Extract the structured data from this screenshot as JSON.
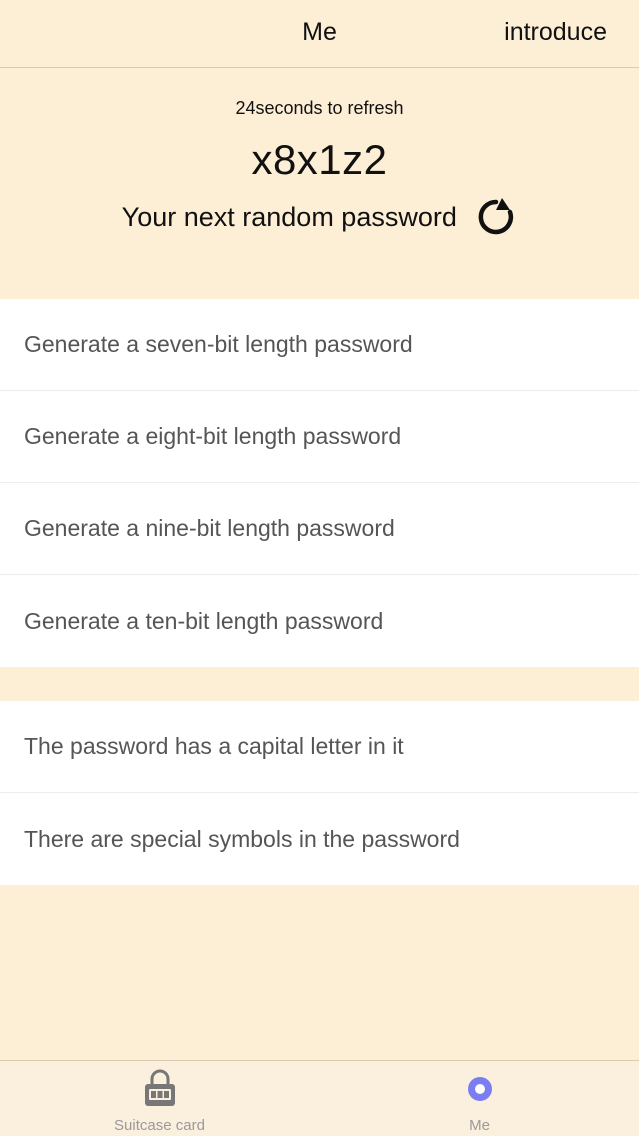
{
  "navbar": {
    "title": "Me",
    "right_button": "introduce"
  },
  "header": {
    "refresh_text": "24seconds to refresh",
    "password": "x8x1z2",
    "next_label": "Your next random password"
  },
  "length_options": [
    {
      "label": "Generate a seven-bit length password"
    },
    {
      "label": "Generate a eight-bit length password"
    },
    {
      "label": "Generate a nine-bit length password"
    },
    {
      "label": "Generate a ten-bit length password"
    }
  ],
  "rule_options": [
    {
      "label": "The password has a capital letter in it"
    },
    {
      "label": "There are special symbols in the password"
    }
  ],
  "tabbar": {
    "tabs": [
      {
        "label": "Suitcase card",
        "icon": "padlock-icon",
        "active": false
      },
      {
        "label": "Me",
        "icon": "dot-circle-icon",
        "active": true
      }
    ],
    "active_color": "#7b7ef0"
  },
  "colors": {
    "background": "#fdeed6",
    "list_background": "#ffffff",
    "list_text": "#555555"
  }
}
